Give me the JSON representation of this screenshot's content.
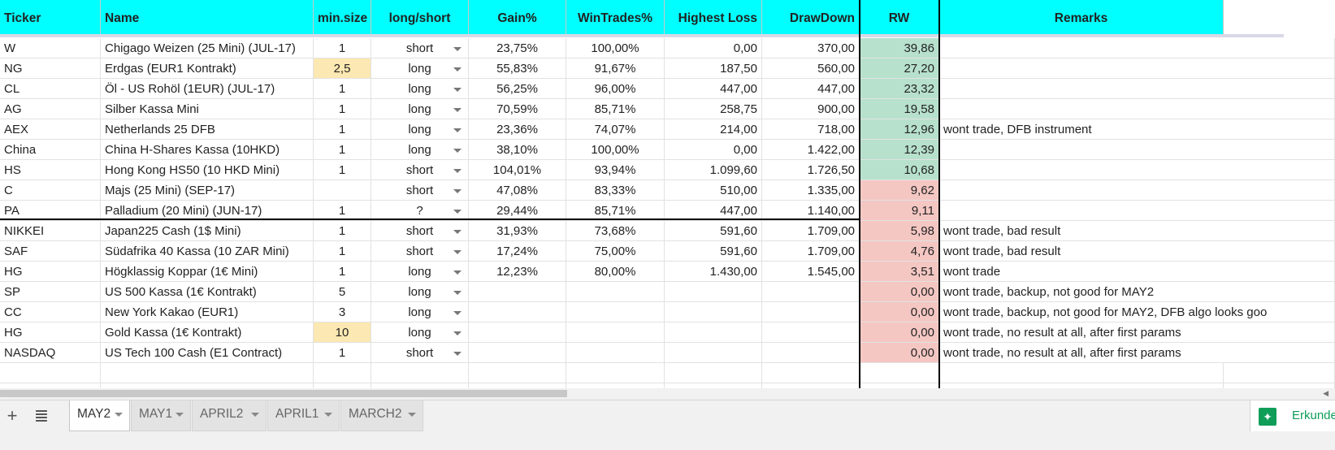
{
  "headers": {
    "ticker": "Ticker",
    "name": "Name",
    "minsize": "min.size",
    "longshort": "long/short",
    "gain": "Gain%",
    "wintrades": "WinTrades%",
    "highestloss": "Highest Loss",
    "drawdown": "DrawDown",
    "rw": "RW",
    "remarks": "Remarks"
  },
  "rows": [
    {
      "ticker": "W",
      "name": "Chigago Weizen (25 Mini) (JUL-17)",
      "minsize": "1",
      "longshort": "short",
      "gain": "23,75%",
      "wintrades": "100,00%",
      "highestloss": "0,00",
      "drawdown": "370,00",
      "rw": "39,86",
      "remarks": "",
      "minsize_color": "",
      "rw_color": "green"
    },
    {
      "ticker": "NG",
      "name": "Erdgas (EUR1 Kontrakt)",
      "minsize": "2,5",
      "longshort": "long",
      "gain": "55,83%",
      "wintrades": "91,67%",
      "highestloss": "187,50",
      "drawdown": "560,00",
      "rw": "27,20",
      "remarks": "",
      "minsize_color": "yellow",
      "rw_color": "green"
    },
    {
      "ticker": "CL",
      "name": "Öl - US Rohöl (1EUR) (JUL-17)",
      "minsize": "1",
      "longshort": "long",
      "gain": "56,25%",
      "wintrades": "96,00%",
      "highestloss": "447,00",
      "drawdown": "447,00",
      "rw": "23,32",
      "remarks": "",
      "minsize_color": "",
      "rw_color": "green"
    },
    {
      "ticker": "AG",
      "name": "Silber Kassa Mini",
      "minsize": "1",
      "longshort": "long",
      "gain": "70,59%",
      "wintrades": "85,71%",
      "highestloss": "258,75",
      "drawdown": "900,00",
      "rw": "19,58",
      "remarks": "",
      "minsize_color": "",
      "rw_color": "green"
    },
    {
      "ticker": "AEX",
      "name": "Netherlands 25 DFB",
      "minsize": "1",
      "longshort": "long",
      "gain": "23,36%",
      "wintrades": "74,07%",
      "highestloss": "214,00",
      "drawdown": "718,00",
      "rw": "12,96",
      "remarks": "wont trade, DFB instrument",
      "minsize_color": "",
      "rw_color": "green"
    },
    {
      "ticker": "China",
      "name": "China H-Shares Kassa (10HKD)",
      "minsize": "1",
      "longshort": "long",
      "gain": "38,10%",
      "wintrades": "100,00%",
      "highestloss": "0,00",
      "drawdown": "1.422,00",
      "rw": "12,39",
      "remarks": "",
      "minsize_color": "",
      "rw_color": "green"
    },
    {
      "ticker": "HS",
      "name": "Hong Kong HS50 (10 HKD Mini)",
      "minsize": "1",
      "longshort": "short",
      "gain": "104,01%",
      "wintrades": "93,94%",
      "highestloss": "1.099,60",
      "drawdown": "1.726,50",
      "rw": "10,68",
      "remarks": "",
      "minsize_color": "",
      "rw_color": "green"
    },
    {
      "ticker": "C",
      "name": "Majs (25 Mini) (SEP-17)",
      "minsize": "",
      "longshort": "short",
      "gain": "47,08%",
      "wintrades": "83,33%",
      "highestloss": "510,00",
      "drawdown": "1.335,00",
      "rw": "9,62",
      "remarks": "",
      "minsize_color": "",
      "rw_color": "red"
    },
    {
      "ticker": "PA",
      "name": "Palladium (20 Mini) (JUN-17)",
      "minsize": "1",
      "longshort": "?",
      "gain": "29,44%",
      "wintrades": "85,71%",
      "highestloss": "447,00",
      "drawdown": "1.140,00",
      "rw": "9,11",
      "remarks": "",
      "minsize_color": "",
      "rw_color": "red"
    },
    {
      "ticker": "NIKKEI",
      "name": "Japan225 Cash (1$ Mini)",
      "minsize": "1",
      "longshort": "short",
      "gain": "31,93%",
      "wintrades": "73,68%",
      "highestloss": "591,60",
      "drawdown": "1.709,00",
      "rw": "5,98",
      "remarks": "wont trade, bad result",
      "minsize_color": "",
      "rw_color": "red"
    },
    {
      "ticker": "SAF",
      "name": "Südafrika 40 Kassa (10 ZAR Mini)",
      "minsize": "1",
      "longshort": "short",
      "gain": "17,24%",
      "wintrades": "75,00%",
      "highestloss": "591,60",
      "drawdown": "1.709,00",
      "rw": "4,76",
      "remarks": "wont trade, bad result",
      "minsize_color": "",
      "rw_color": "red"
    },
    {
      "ticker": "HG",
      "name": "Högklassig Koppar (1€ Mini)",
      "minsize": "1",
      "longshort": "long",
      "gain": "12,23%",
      "wintrades": "80,00%",
      "highestloss": "1.430,00",
      "drawdown": "1.545,00",
      "rw": "3,51",
      "remarks": "wont trade",
      "minsize_color": "",
      "rw_color": "red"
    },
    {
      "ticker": "SP",
      "name": "US 500 Kassa (1€ Kontrakt)",
      "minsize": "5",
      "longshort": "long",
      "gain": "",
      "wintrades": "",
      "highestloss": "",
      "drawdown": "",
      "rw": "0,00",
      "remarks": "wont trade, backup, not good for MAY2",
      "minsize_color": "",
      "rw_color": "red"
    },
    {
      "ticker": "CC",
      "name": "New York Kakao (EUR1)",
      "minsize": "3",
      "longshort": "long",
      "gain": "",
      "wintrades": "",
      "highestloss": "",
      "drawdown": "",
      "rw": "0,00",
      "remarks": "wont trade, backup, not good for MAY2, DFB algo looks goo",
      "minsize_color": "",
      "rw_color": "red"
    },
    {
      "ticker": "HG",
      "name": "Gold Kassa (1€ Kontrakt)",
      "minsize": "10",
      "longshort": "long",
      "gain": "",
      "wintrades": "",
      "highestloss": "",
      "drawdown": "",
      "rw": "0,00",
      "remarks": "wont trade, no result at all, after first params",
      "minsize_color": "yellow",
      "rw_color": "red"
    },
    {
      "ticker": "NASDAQ",
      "name": "US Tech 100 Cash (E1 Contract)",
      "minsize": "1",
      "longshort": "short",
      "gain": "",
      "wintrades": "",
      "highestloss": "",
      "drawdown": "",
      "rw": "0,00",
      "remarks": "wont trade, no result at all, after first params",
      "minsize_color": "",
      "rw_color": "red"
    }
  ],
  "tabs": [
    "MAY2",
    "MAY1",
    "APRIL2",
    "APRIL1",
    "MARCH2"
  ],
  "active_tab": "MAY2",
  "toolbar": {
    "add_sheet": "+",
    "all_sheets": "≣"
  },
  "explore": {
    "label": "Erkunden",
    "icon": "explore-icon"
  },
  "colors": {
    "header": "#00ffff",
    "green": "#b7e1cd",
    "red": "#f4c7c3",
    "yellow": "#fce8b2"
  }
}
